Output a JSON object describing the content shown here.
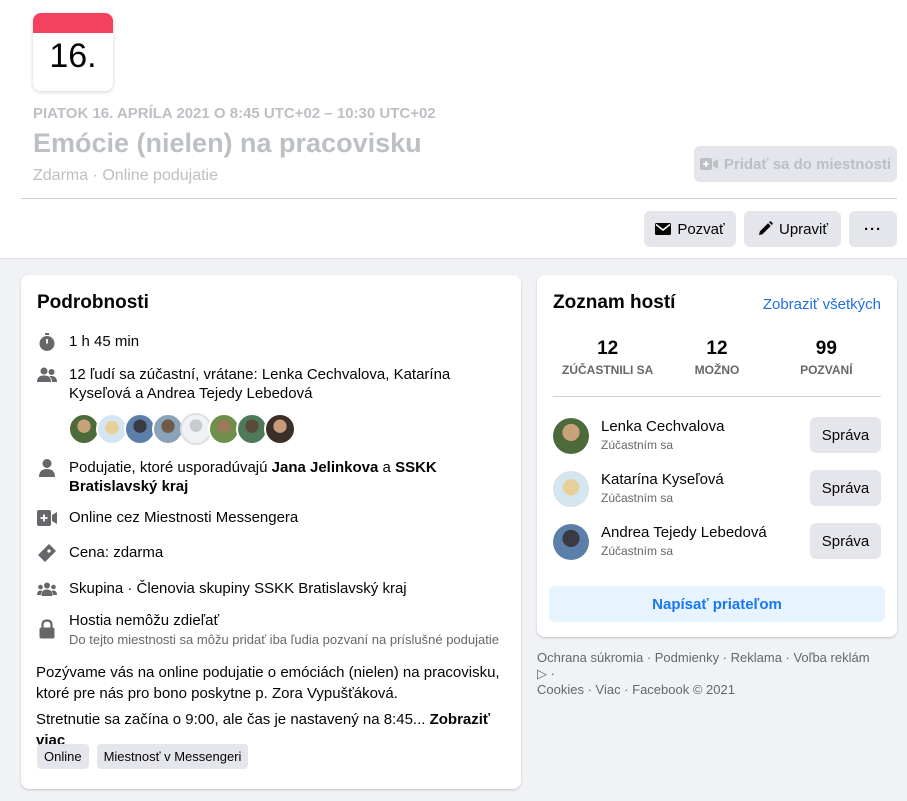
{
  "calendar": {
    "day": "16."
  },
  "event": {
    "date": "PIATOK 16. APRÍLA 2021 O 8:45 UTC+02 – 10:30 UTC+02",
    "title": "Emócie (nielen) na pracovisku",
    "subtitle": "Zdarma · Online podujatie",
    "add_room_label": "Pridať sa do miestnosti"
  },
  "actions": {
    "invite_label": "Pozvať",
    "edit_label": "Upraviť",
    "more_label": "···"
  },
  "details": {
    "title": "Podrobnosti",
    "duration": "1 h 45 min",
    "attending_text": "12 ľudí sa zúčastní, vrátane: Lenka Cechvalova, Katarína Kyseľová a Andrea Tejedy Lebedová",
    "host_prefix": "Podujatie, ktoré usporadúvajú ",
    "host_1": "Jana Jelinkova",
    "host_and": " a ",
    "host_2": "SSKK Bratislavský kraj",
    "online_text": "Online cez Miestnosti Messengera",
    "price_text": "Cena: zdarma",
    "group_text": "Skupina · Členovia skupiny SSKK Bratislavský kraj",
    "privacy_title": "Hostia nemôžu zdieľať",
    "privacy_sub": "Do tejto miestnosti sa môžu pridať iba ľudia pozvaní na príslušné podujatie",
    "description_1": "Pozývame vás na online podujatie o emóciách (nielen) na pracovisku, ktoré pre nás pro bono poskytne p. Zora Vypušťáková.",
    "description_2": "Stretnutie sa začína o 9:00, ale čas je nastavený na 8:45...",
    "see_more": "Zobraziť viac",
    "tags": [
      "Online",
      "Miestnosť v Messengeri"
    ]
  },
  "guests": {
    "title": "Zoznam hostí",
    "see_all": "Zobraziť všetkých",
    "stats": [
      {
        "count": "12",
        "label": "ZÚČASTNILI SA"
      },
      {
        "count": "12",
        "label": "MOŽNO"
      },
      {
        "count": "99",
        "label": "POZVANÍ"
      }
    ],
    "list": [
      {
        "name": "Lenka Cechvalova",
        "status": "Zúčastním sa",
        "button": "Správa"
      },
      {
        "name": "Katarína Kyseľová",
        "status": "Zúčastním sa",
        "button": "Správa"
      },
      {
        "name": "Andrea Tejedy Lebedová",
        "status": "Zúčastním sa",
        "button": "Správa"
      }
    ],
    "message_label": "Napísať priateľom"
  },
  "footer": {
    "line1": "Ochrana súkromia · Podmienky · Reklama · Voľba reklám ▷ ·",
    "line2": "Cookies · Viac · Facebook © 2021"
  },
  "colors": {
    "accent": "#1877f2",
    "calendar_red": "#f3425f",
    "muted": "#65676b"
  }
}
